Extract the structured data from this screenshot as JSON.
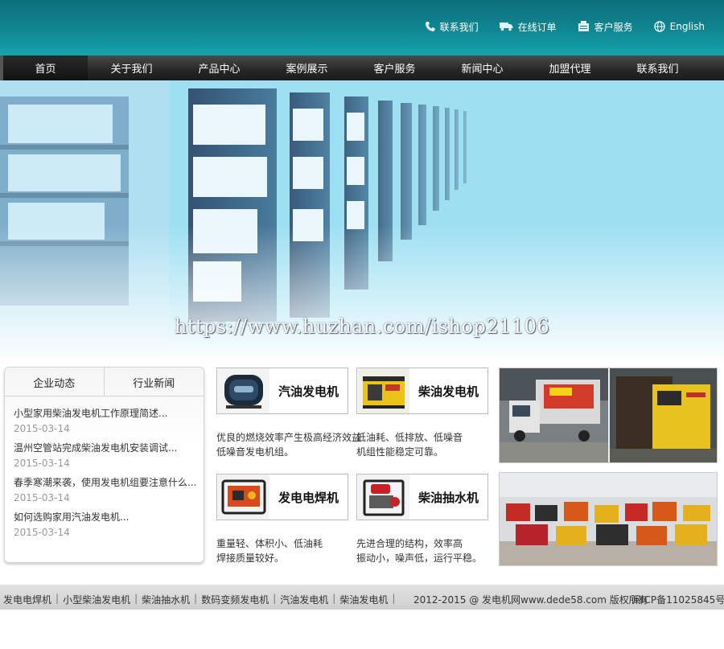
{
  "header": {
    "links": [
      {
        "label": "联系我们",
        "icon": "phone-icon"
      },
      {
        "label": "在线订单",
        "icon": "truck-icon"
      },
      {
        "label": "客户服务",
        "icon": "service-icon"
      },
      {
        "label": "English",
        "icon": "globe-icon"
      }
    ]
  },
  "nav": {
    "items": [
      "首页",
      "关于我们",
      "产品中心",
      "案例展示",
      "客户服务",
      "新闻中心",
      "加盟代理",
      "联系我们"
    ]
  },
  "banner": {
    "watermark": "https://www.huzhan.com/ishop21106"
  },
  "news": {
    "tabs": [
      "企业动态",
      "行业新闻"
    ],
    "items": [
      {
        "title": "小型家用柴油发电机工作原理简述...",
        "date": "2015-03-14"
      },
      {
        "title": "温州空管站完成柴油发电机安装调试...",
        "date": "2015-03-14"
      },
      {
        "title": "春季寒潮来袭，使用发电机组要注意什么...",
        "date": "2015-03-14"
      },
      {
        "title": "如何选购家用汽油发电机...",
        "date": "2015-03-14"
      }
    ]
  },
  "products": [
    {
      "label": "汽油发电机",
      "desc1": "优良的燃烧效率产生极高经济效益",
      "desc2": "低噪音发电机组。"
    },
    {
      "label": "柴油发电机",
      "desc1": "低油耗、低排放、低噪音",
      "desc2": "机组性能稳定可靠。"
    },
    {
      "label": "发电电焊机",
      "desc1": "重量轻、体积小、低油耗",
      "desc2": "焊接质量较好。"
    },
    {
      "label": "柴油抽水机",
      "desc1": "先进合理的结构，效率高",
      "desc2": "振动小，噪声低，运行平稳。"
    }
  ],
  "footer": {
    "links": [
      "发电电焊机",
      "小型柴油发电机",
      "柴油抽水机",
      "数码变频发电机",
      "汽油发电机",
      "柴油发电机"
    ],
    "copyright": "2012-2015 @ 发电机网www.dede58.com 版权所有",
    "icp": "闽ICP备11025845号"
  },
  "colors": {
    "header": "#0f8793",
    "nav": "#262626",
    "banner": "#a9e6f5"
  }
}
